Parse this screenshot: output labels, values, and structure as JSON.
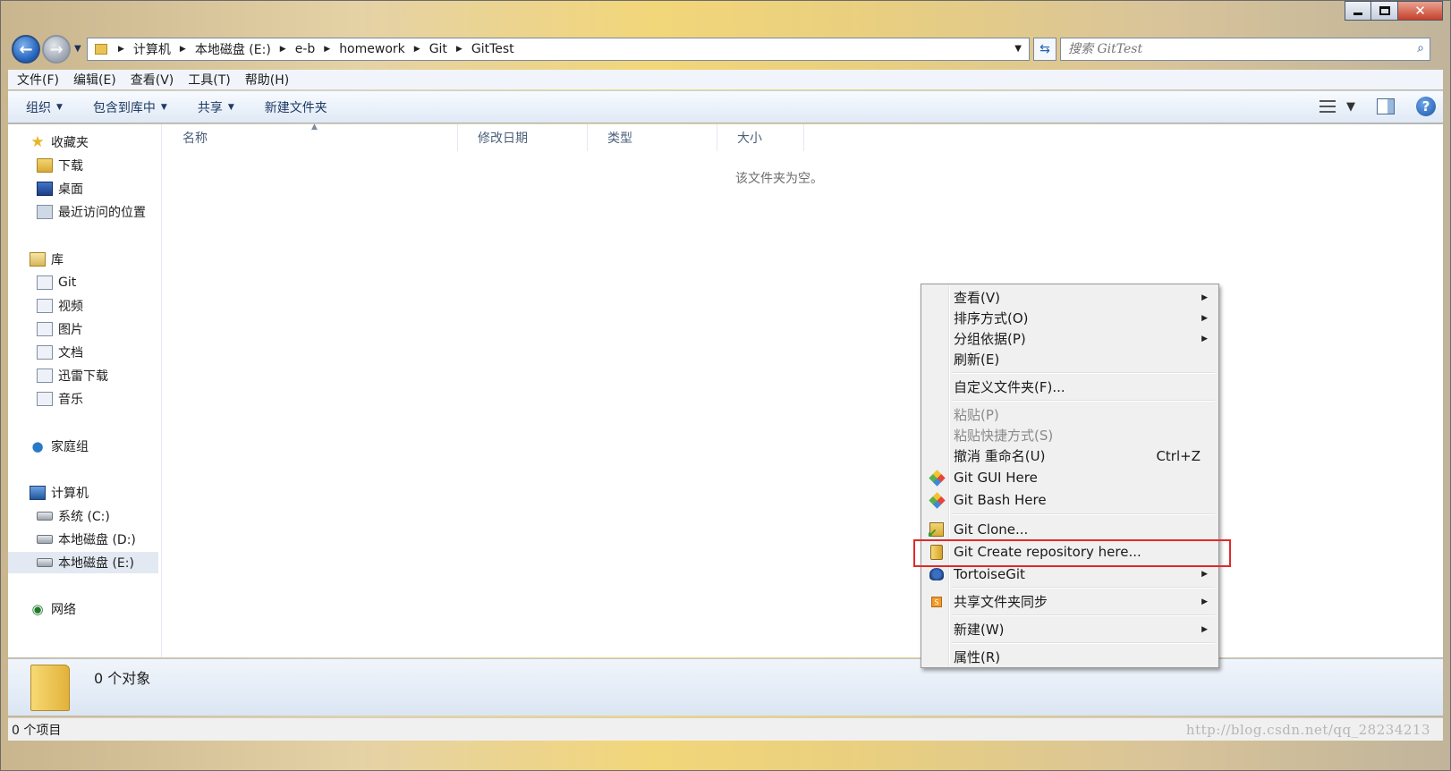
{
  "breadcrumb": [
    "计算机",
    "本地磁盘 (E:)",
    "e-b",
    "homework",
    "Git",
    "GitTest"
  ],
  "search": {
    "placeholder": "搜索 GitTest"
  },
  "menubar": [
    "文件(F)",
    "编辑(E)",
    "查看(V)",
    "工具(T)",
    "帮助(H)"
  ],
  "toolbar": {
    "organize": "组织",
    "include": "包含到库中",
    "share": "共享",
    "new_folder": "新建文件夹"
  },
  "sidebar": {
    "favorites": "收藏夹",
    "fav_items": [
      "下载",
      "桌面",
      "最近访问的位置"
    ],
    "libraries": "库",
    "lib_items": [
      "Git",
      "视频",
      "图片",
      "文档",
      "迅雷下载",
      "音乐"
    ],
    "homegroup": "家庭组",
    "computer": "计算机",
    "drives": [
      "系统 (C:)",
      "本地磁盘 (D:)",
      "本地磁盘 (E:)"
    ],
    "network": "网络"
  },
  "columns": [
    "名称",
    "修改日期",
    "类型",
    "大小"
  ],
  "empty_text": "该文件夹为空。",
  "details": {
    "count": "0 个对象"
  },
  "status": {
    "items": "0 个项目",
    "watermark": "http://blog.csdn.net/qq_28234213"
  },
  "context_menu": {
    "view": "查看(V)",
    "sort": "排序方式(O)",
    "group": "分组依据(P)",
    "refresh": "刷新(E)",
    "customize": "自定义文件夹(F)...",
    "paste": "粘贴(P)",
    "paste_shortcut": "粘贴快捷方式(S)",
    "undo": "撤消 重命名(U)",
    "undo_shortcut": "Ctrl+Z",
    "git_gui": "Git GUI Here",
    "git_bash": "Git Bash Here",
    "git_clone": "Git Clone...",
    "git_create": "Git Create repository here...",
    "tortoise": "TortoiseGit",
    "share_sync": "共享文件夹同步",
    "new": "新建(W)",
    "properties": "属性(R)"
  },
  "colors": {
    "highlight_box": "#e02a2a",
    "accent": "#1f5fb8"
  }
}
